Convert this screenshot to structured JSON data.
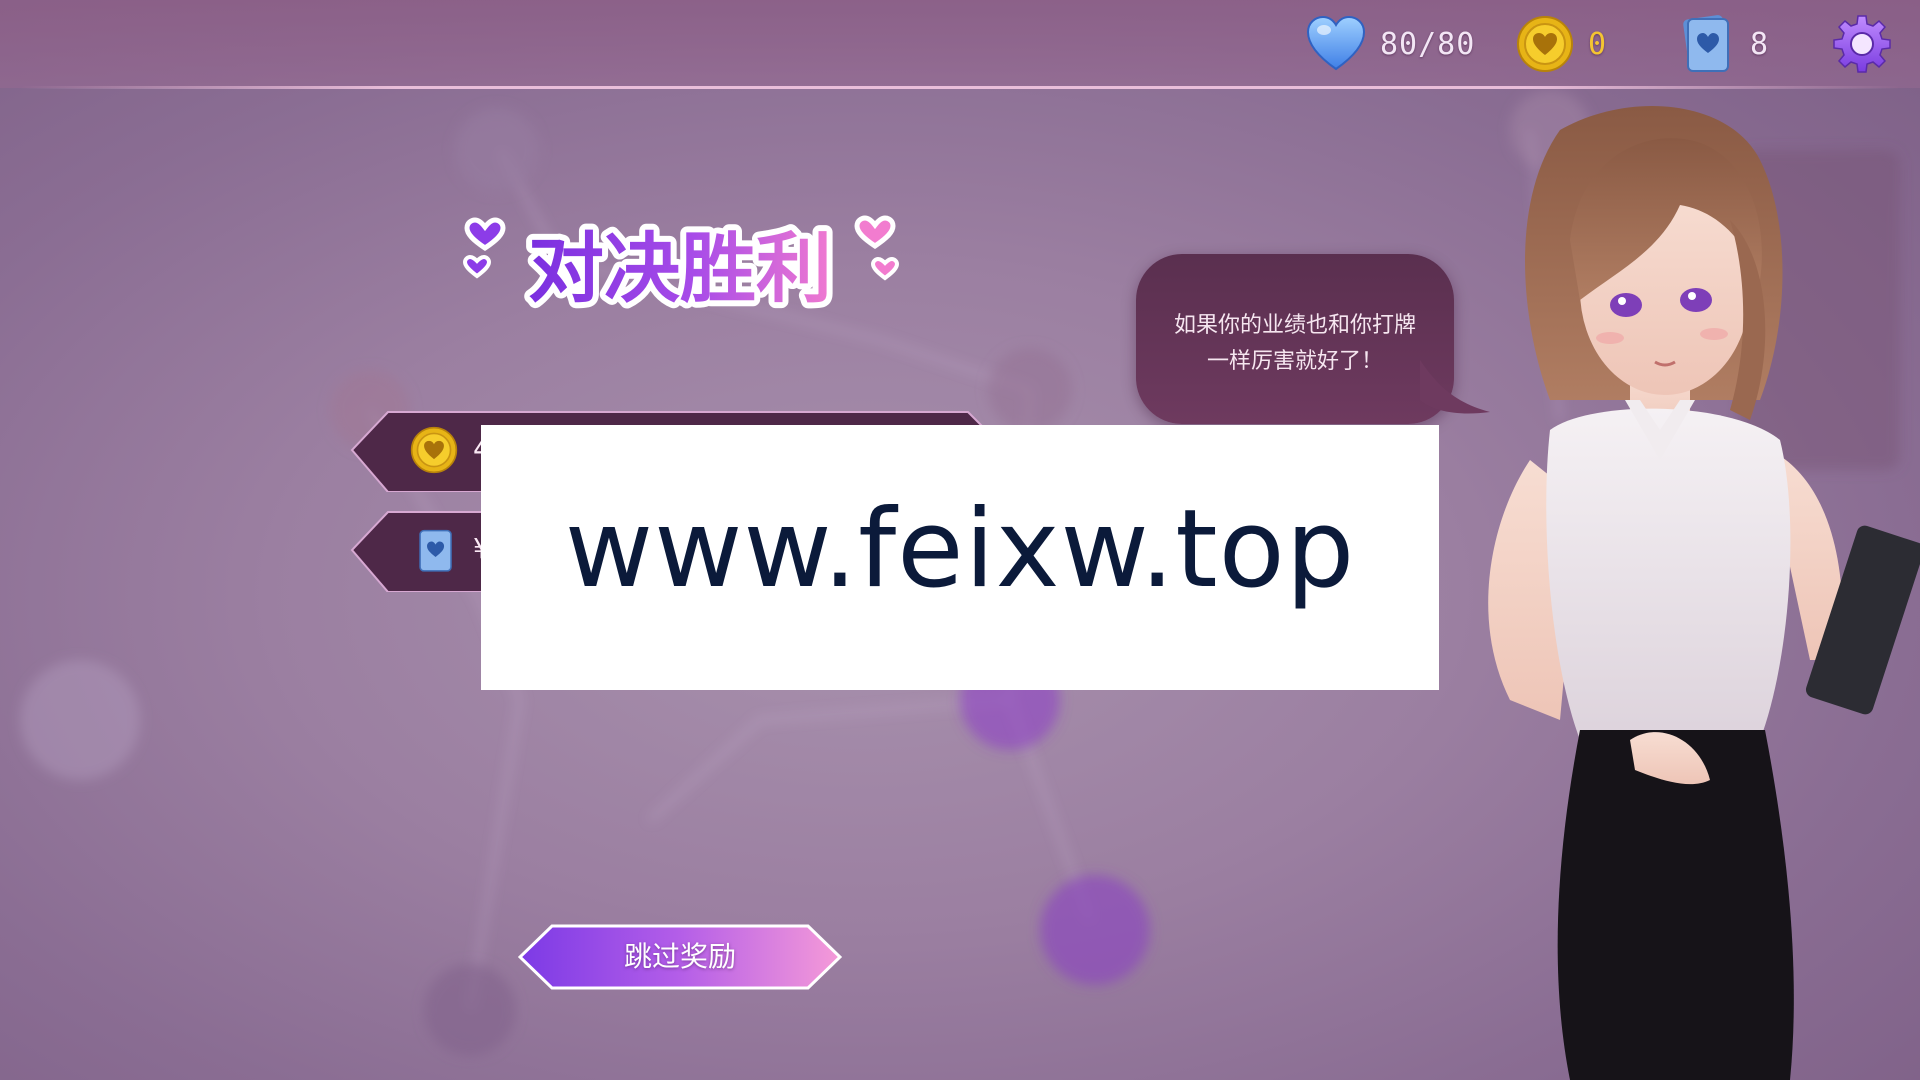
{
  "top_bar": {
    "hp": {
      "icon": "heart-icon",
      "value": "80/80",
      "color": "#f3e6f5"
    },
    "gold": {
      "icon": "gold-coin-icon",
      "value": "0",
      "color": "#f4c531"
    },
    "cards": {
      "icon": "card-deck-icon",
      "value": "8",
      "color": "#f3e6f5"
    },
    "settings_icon": "gear-icon"
  },
  "title": "对决胜利",
  "rewards": [
    {
      "icon": "gold-coin-icon",
      "label": "4"
    },
    {
      "icon": "card-icon",
      "label": "¥"
    }
  ],
  "skip_button": {
    "label": "跳过奖励"
  },
  "speech": {
    "line1": "如果你的业绩也和你打牌",
    "line2": "一样厉害就好了！"
  },
  "watermark": {
    "text": "www.feixw.top"
  },
  "colors": {
    "accent_purple": "#8b3df0",
    "accent_pink": "#f38ad3",
    "bubble": "#5e3354",
    "row_bg": "#4a2744"
  }
}
